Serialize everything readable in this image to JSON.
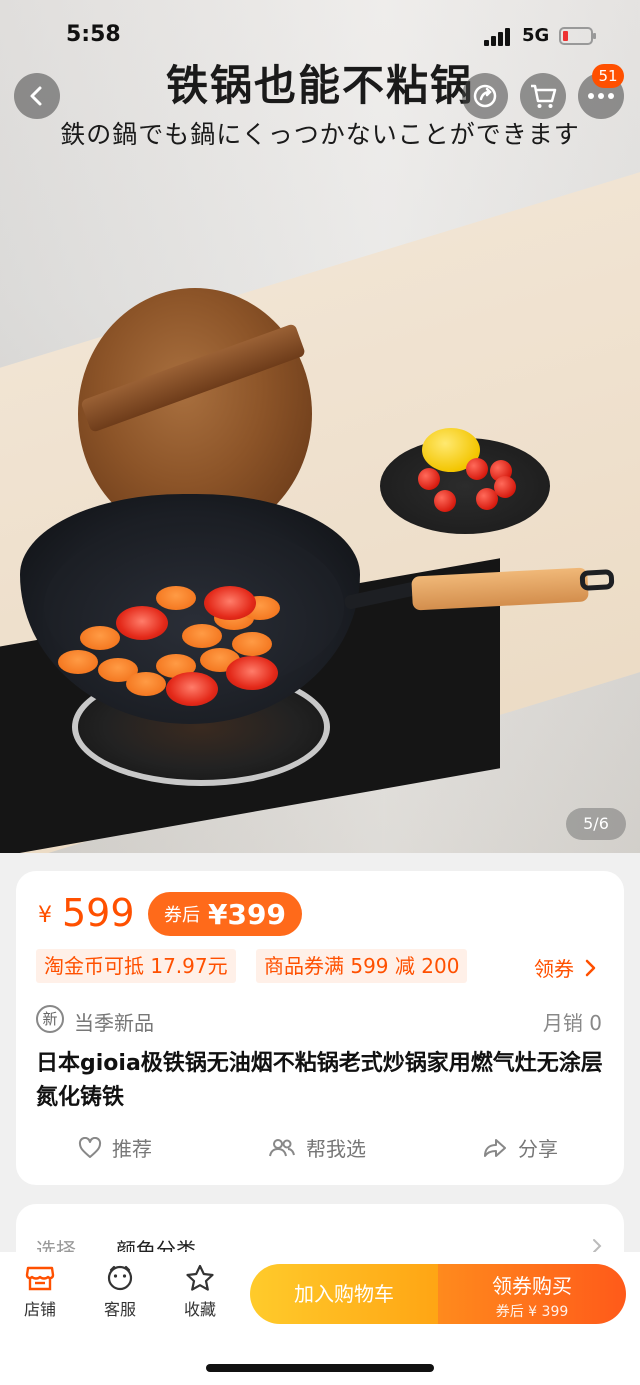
{
  "status_bar": {
    "time": "5:58",
    "network": "5G"
  },
  "hero": {
    "title": "铁锅也能不粘锅",
    "subtitle": "鉄の鍋でも鍋にくっつかないことができます",
    "cart_badge": "51",
    "page_indicator": "5/6"
  },
  "price": {
    "currency": "¥",
    "original": "599",
    "coupon_prefix": "券后",
    "coupon_price": "¥399"
  },
  "tags": {
    "coin": "淘金币可抵 17.97元",
    "coupon": "商品券满 599 减 200",
    "get_coupon": "领券"
  },
  "product": {
    "new_icon": "新",
    "new_label": "当季新品",
    "monthly_sales": "月销 0",
    "title": "日本gioia极铁锅无油烟不粘锅老式炒锅家用燃气灶无涂层氮化铸铁"
  },
  "actions": {
    "recommend": "推荐",
    "help_choose": "帮我选",
    "share": "分享"
  },
  "options": {
    "label": "选择",
    "value": "颜色分类"
  },
  "bottom_bar": {
    "shop": "店铺",
    "service": "客服",
    "favorite": "收藏",
    "add_cart": "加入购物车",
    "buy": "领券购买",
    "buy_sub": "券后 ¥ 399"
  },
  "colors": {
    "accent": "#ff5000",
    "cart_button": "#ffb31f",
    "buy_button": "#ff6a1a"
  }
}
